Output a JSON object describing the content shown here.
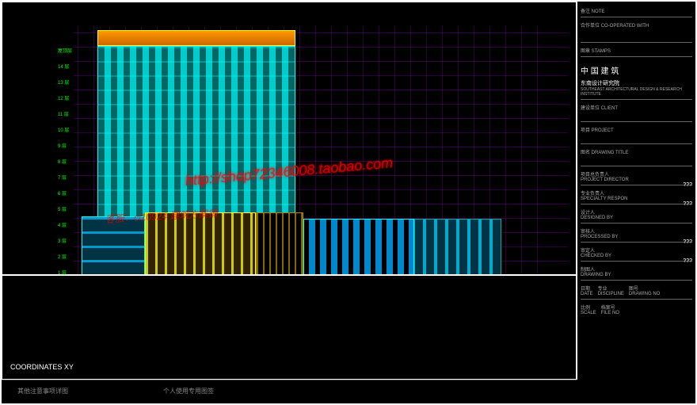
{
  "title_block": {
    "note_label": "备注 NOTE",
    "coop_label": "合作单位 CO-OPERATED WITH",
    "stamp_label": "图章 STAMPS",
    "logo_cn": "中 国 建 筑",
    "logo_sub": "东南设计研究院",
    "logo_en": "SOUTHEAST ARCHITECTURAL DESIGN & RESEARCH INSTITUTE",
    "client_label": "建设单位 CLIENT",
    "project_label": "项目 PROJECT",
    "drawing_title_label": "图名 DRAWING TITLE",
    "director_label": "项目总负责人",
    "director_en": "PROJECT DIRECTOR",
    "respon_label": "专业负责人",
    "respon_en": "SPECIALTY RESPON",
    "designed_label": "设计人",
    "designed_en": "DESIGNED BY",
    "processed_label": "审核人",
    "processed_en": "PROCESSED BY",
    "checked_label": "审定人",
    "checked_en": "CHECKED BY",
    "drawn_label": "制图人",
    "drawn_en": "DRAWING BY",
    "date_label": "日期",
    "date_en": "DATE",
    "discipline_label": "专业",
    "discipline_en": "DISCIPLINE",
    "scale_label": "比例",
    "scale_en": "SCALE",
    "dwgno_label": "图号",
    "dwgno_en": "DRAWING NO",
    "fileno_label": "档案号",
    "fileno_en": "FILE NO",
    "placeholder": "???"
  },
  "floors": [
    {
      "offset": 0,
      "label": "1 层"
    },
    {
      "offset": 20,
      "label": "2 层"
    },
    {
      "offset": 40,
      "label": "3 层"
    },
    {
      "offset": 60,
      "label": "4 层"
    },
    {
      "offset": 80,
      "label": "5 层"
    },
    {
      "offset": 100,
      "label": "6 层"
    },
    {
      "offset": 120,
      "label": "7 层"
    },
    {
      "offset": 140,
      "label": "8 层"
    },
    {
      "offset": 160,
      "label": "9 层"
    },
    {
      "offset": 180,
      "label": "10 层"
    },
    {
      "offset": 200,
      "label": "11 层"
    },
    {
      "offset": 220,
      "label": "12 层"
    },
    {
      "offset": 240,
      "label": "13 层"
    },
    {
      "offset": 260,
      "label": "14 层"
    },
    {
      "offset": 280,
      "label": "屋顶层"
    }
  ],
  "coord": "COORDINATES XY",
  "watermark_url": "http://shop72346008.taobao.com",
  "watermark_text": "客服：cl10924  建筑方案铺",
  "bottom": {
    "left": "其他注意事项详图",
    "right": "个人使用专用图签"
  }
}
